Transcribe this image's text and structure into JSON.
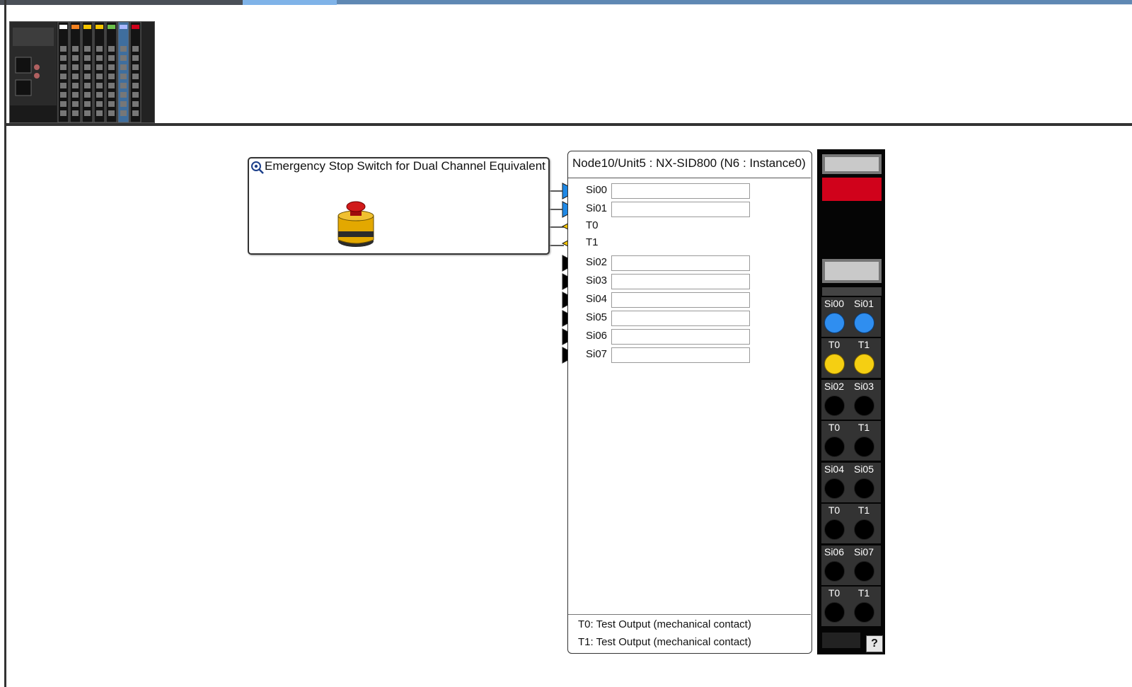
{
  "function_block": {
    "title": "Emergency Stop Switch for Dual Channel Equivalent",
    "icon": "gear-search-icon",
    "device_image": "emergency-stop-button"
  },
  "unit": {
    "title": "Node10/Unit5 : NX-SID800 (N6 : Instance0)",
    "ports": [
      {
        "label": "Si00",
        "type": "input",
        "color": "#1e88e5",
        "value": ""
      },
      {
        "label": "Si01",
        "type": "input",
        "color": "#1e88e5",
        "value": ""
      },
      {
        "label": "T0",
        "type": "test-output",
        "color": "#f2c200"
      },
      {
        "label": "T1",
        "type": "test-output",
        "color": "#f2c200"
      },
      {
        "label": "Si02",
        "type": "input",
        "color": "#000000",
        "value": ""
      },
      {
        "label": "Si03",
        "type": "input",
        "color": "#000000",
        "value": ""
      },
      {
        "label": "Si04",
        "type": "input",
        "color": "#000000",
        "value": ""
      },
      {
        "label": "Si05",
        "type": "input",
        "color": "#000000",
        "value": ""
      },
      {
        "label": "Si06",
        "type": "input",
        "color": "#000000",
        "value": ""
      },
      {
        "label": "Si07",
        "type": "input",
        "color": "#000000",
        "value": ""
      }
    ],
    "footer": [
      "T0: Test Output (mechanical contact)",
      "T1: Test Output (mechanical contact)"
    ]
  },
  "module": {
    "terminals": [
      {
        "left": "Si00",
        "right": "Si01",
        "color": "blue"
      },
      {
        "left": "T0",
        "right": "T1",
        "color": "yellow"
      },
      {
        "left": "Si02",
        "right": "Si03",
        "color": "black"
      },
      {
        "left": "T0",
        "right": "T1",
        "color": "black"
      },
      {
        "left": "Si04",
        "right": "Si05",
        "color": "black"
      },
      {
        "left": "T0",
        "right": "T1",
        "color": "black"
      },
      {
        "left": "Si06",
        "right": "Si07",
        "color": "black"
      },
      {
        "left": "T0",
        "right": "T1",
        "color": "black"
      }
    ],
    "help_label": "?"
  }
}
